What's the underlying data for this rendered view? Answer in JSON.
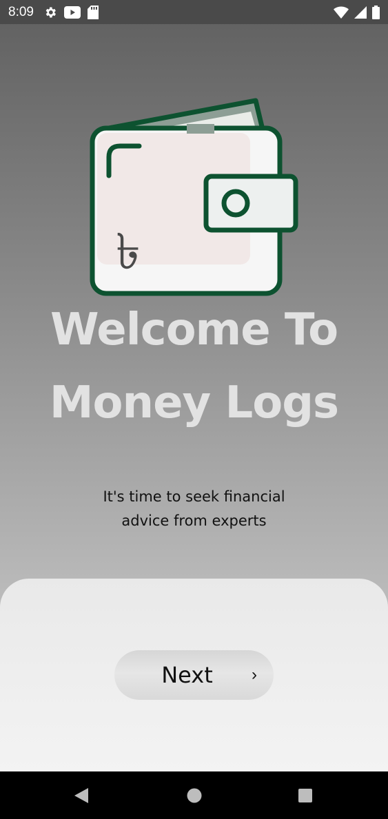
{
  "status_bar": {
    "time": "8:09",
    "left_icons": [
      "gear-icon",
      "youtube-icon",
      "sd-card-icon"
    ],
    "right_icons": [
      "wifi-icon",
      "signal-icon",
      "battery-icon"
    ]
  },
  "hero": {
    "illustration": "wallet-icon",
    "currency_symbol": "৳",
    "accent_color": "#0d5230"
  },
  "title": {
    "line1": "Welcome To",
    "line2": "Money Logs"
  },
  "subtitle": {
    "line1": "It's time to seek financial",
    "line2": "advice from experts"
  },
  "next_button": {
    "label": "Next",
    "chevron": "›"
  },
  "nav_bar": {
    "buttons": [
      "back-icon",
      "home-icon",
      "recents-icon"
    ]
  }
}
